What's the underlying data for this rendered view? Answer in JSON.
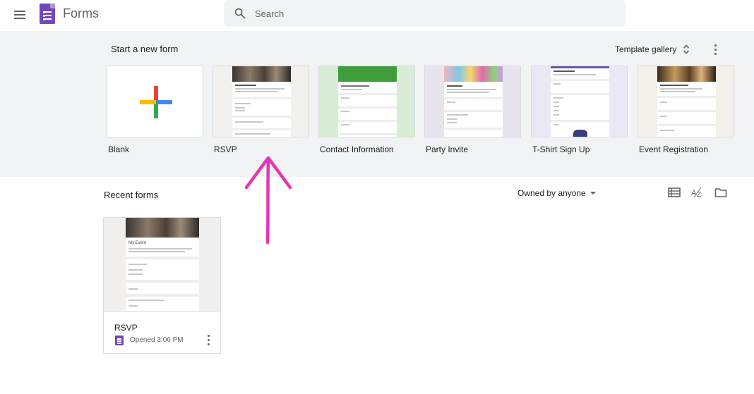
{
  "header": {
    "app_title": "Forms",
    "menu_icon": "hamburger-menu-icon",
    "search_placeholder": "Search",
    "search_value": ""
  },
  "templates": {
    "title": "Start a new form",
    "gallery_label": "Template gallery",
    "items": [
      {
        "label": "Blank"
      },
      {
        "label": "RSVP"
      },
      {
        "label": "Contact Information"
      },
      {
        "label": "Party Invite"
      },
      {
        "label": "T-Shirt Sign Up"
      },
      {
        "label": "Event Registration"
      }
    ]
  },
  "recent": {
    "title": "Recent forms",
    "owner_filter": "Owned by anyone",
    "docs": [
      {
        "name": "RSVP",
        "meta": "Opened 3:06 PM",
        "thumb_title": "My Event"
      }
    ]
  },
  "colors": {
    "brand": "#7248b9",
    "annotation": "#e535b4",
    "section_bg": "#f1f3f4"
  }
}
